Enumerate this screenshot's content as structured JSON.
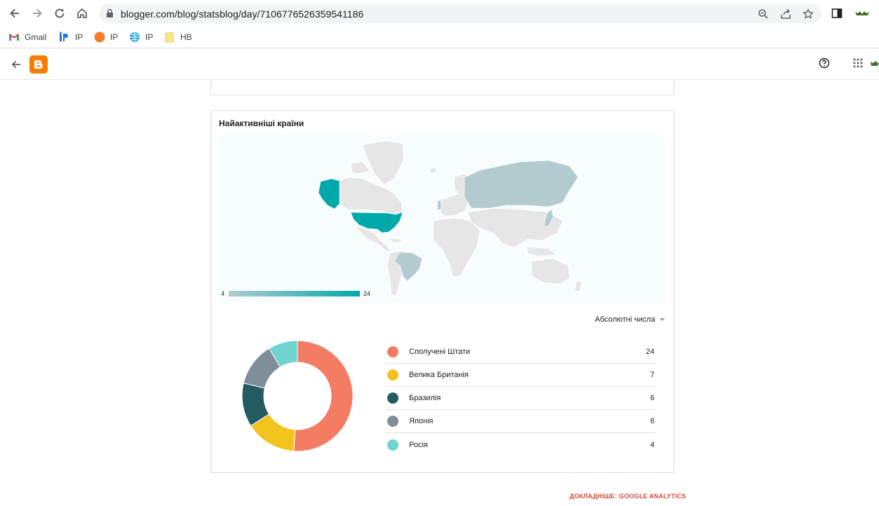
{
  "browser": {
    "url": "blogger.com/blog/statsblog/day/7106776526359541186",
    "bookmarks": [
      {
        "label": "Gmail",
        "icon": "gmail-icon"
      },
      {
        "label": "IP",
        "icon": "ip-blue-icon"
      },
      {
        "label": "IP",
        "icon": "orange-circle-icon"
      },
      {
        "label": "IP",
        "icon": "globe-icon"
      },
      {
        "label": "НВ",
        "icon": "folder-icon"
      }
    ]
  },
  "card": {
    "title": "Найактивніші країни",
    "map": {
      "scale_min": "4",
      "scale_max": "24",
      "scale_colors": {
        "low": "#b3cbcf",
        "high": "#00a9a9"
      }
    },
    "dropdown_label": "Абсолютні числа",
    "legend": [
      {
        "label": "Сполучені Штати",
        "value": "24",
        "color": "#f47c63"
      },
      {
        "label": "Велика Британія",
        "value": "7",
        "color": "#f2c31c"
      },
      {
        "label": "Бразилія",
        "value": "6",
        "color": "#245a62"
      },
      {
        "label": "Японія",
        "value": "6",
        "color": "#7f8f9a"
      },
      {
        "label": "Росія",
        "value": "4",
        "color": "#6fd4d0"
      }
    ]
  },
  "footer": {
    "ga_link": "ДОКЛАДНІШЕ: GOOGLE ANALYTICS"
  },
  "chart_data": {
    "type": "pie",
    "categories": [
      "Сполучені Штати",
      "Велика Британія",
      "Бразилія",
      "Японія",
      "Росія"
    ],
    "values": [
      24,
      7,
      6,
      6,
      4
    ],
    "colors": [
      "#f47c63",
      "#f2c31c",
      "#245a62",
      "#7f8f9a",
      "#6fd4d0"
    ],
    "donut": true
  }
}
